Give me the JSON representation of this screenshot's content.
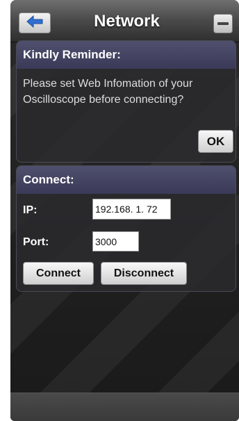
{
  "header": {
    "title": "Network",
    "back_icon": "back-arrow-icon",
    "minimize_icon": "minus-icon",
    "accent": "#2f6fd0"
  },
  "reminder": {
    "title": "Kindly Reminder:",
    "message": "Please set Web Infomation of your Oscilloscope before connecting?",
    "ok_label": "OK"
  },
  "connect": {
    "title": "Connect:",
    "ip_label": "IP:",
    "ip_value": "192.168.   1. 72",
    "port_label": "Port:",
    "port_value": "3000",
    "connect_label": "Connect",
    "disconnect_label": "Disconnect"
  }
}
